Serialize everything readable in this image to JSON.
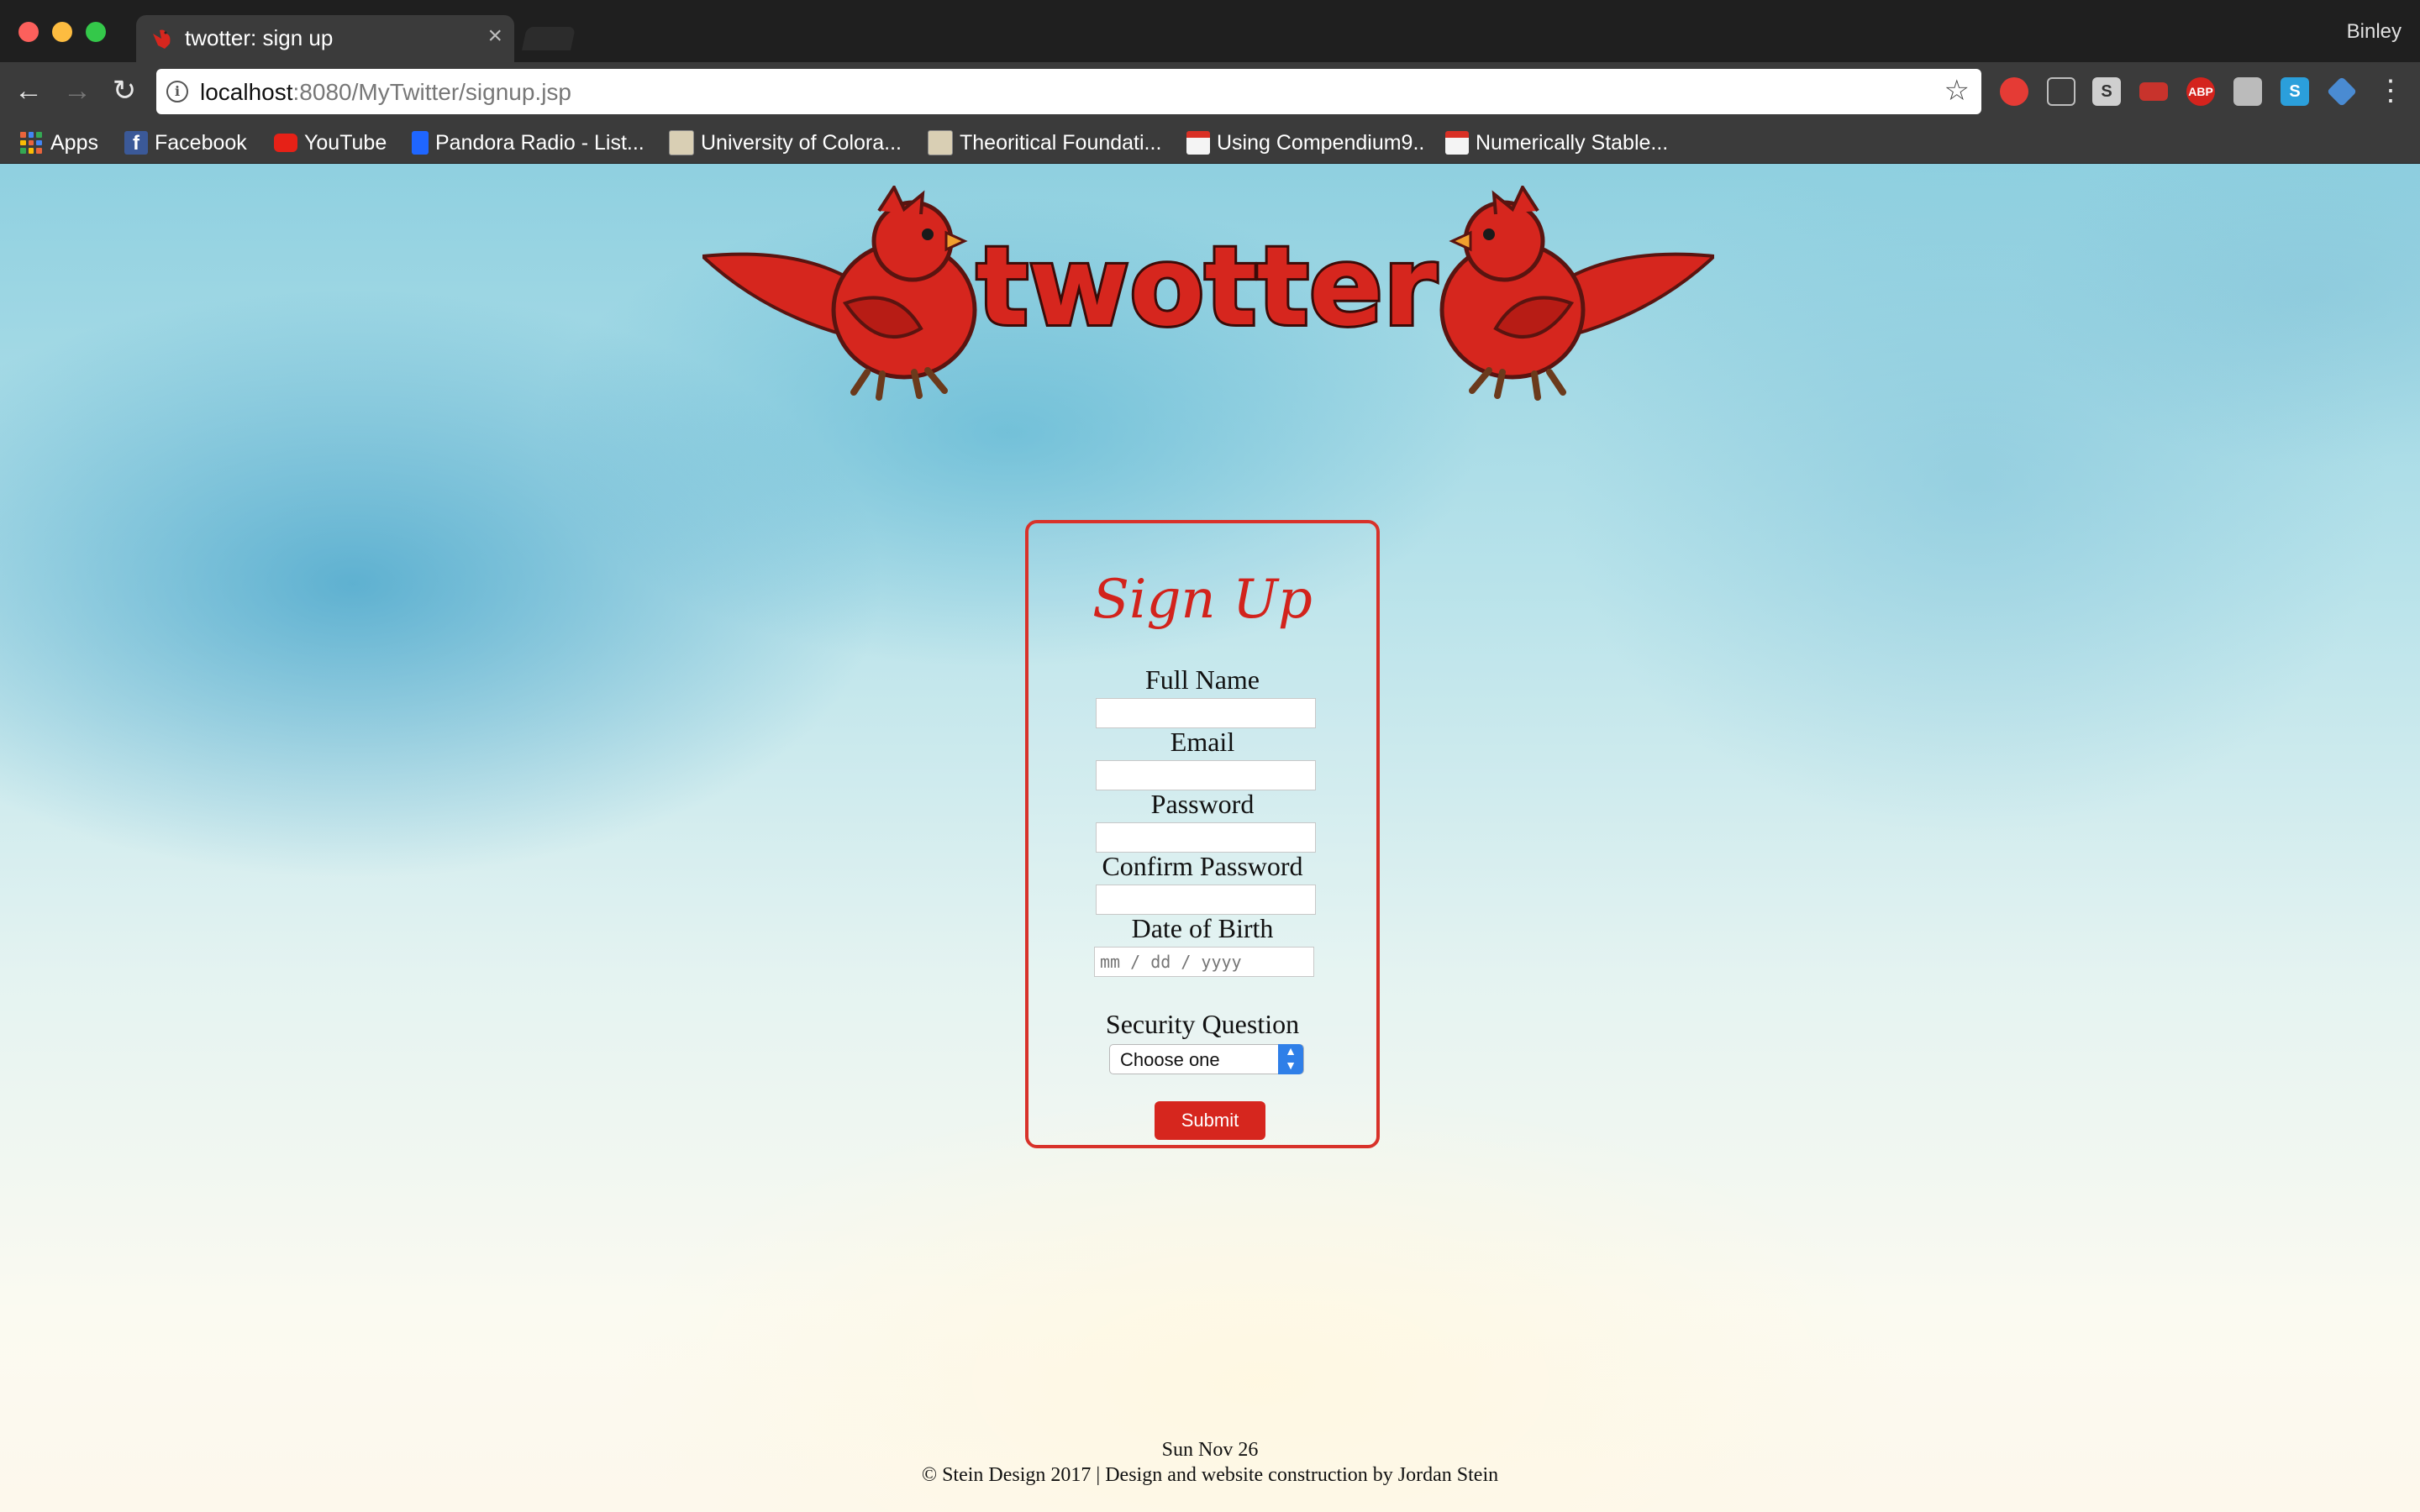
{
  "browser": {
    "tab_title": "twotter: sign up",
    "tab_close": "×",
    "profile_name": "Binley",
    "url_host": "localhost",
    "url_path": ":8080/MyTwitter/signup.jsp"
  },
  "bookmarks": [
    {
      "label": "Apps"
    },
    {
      "label": "Facebook"
    },
    {
      "label": "YouTube"
    },
    {
      "label": "Pandora Radio - List..."
    },
    {
      "label": "University of Colora..."
    },
    {
      "label": "Theoritical Foundati..."
    },
    {
      "label": "Using Compendium9.."
    },
    {
      "label": "Numerically Stable..."
    }
  ],
  "extensions": [
    {
      "icon": "shield-icon",
      "color": "#e53b35"
    },
    {
      "icon": "glasses-icon",
      "color": "#4a4a4a"
    },
    {
      "icon": "s-badge-icon",
      "label": "S",
      "color": "#cfcfcf"
    },
    {
      "icon": "red-box-icon",
      "color": "#c8332c"
    },
    {
      "icon": "adblock-icon",
      "label": "ABP",
      "color": "#d4231d"
    },
    {
      "icon": "cat-icon",
      "color": "#bbbbbb"
    },
    {
      "icon": "skype-icon",
      "label": "S",
      "color": "#2b9fdb"
    },
    {
      "icon": "cube-icon",
      "color": "#4a8bd2"
    }
  ],
  "logo": {
    "text": "twotter"
  },
  "form": {
    "title": "Sign Up",
    "full_name_label": "Full Name",
    "email_label": "Email",
    "password_label": "Password",
    "confirm_password_label": "Confirm Password",
    "dob_label": "Date of Birth",
    "dob_placeholder": "mm / dd / yyyy",
    "security_label": "Security Question",
    "security_selected": "Choose one",
    "submit_label": "Submit"
  },
  "footer": {
    "date": "Sun Nov 26",
    "copyright": "© Stein Design 2017 | Design and website construction by Jordan Stein"
  },
  "colors": {
    "brand_red": "#d6261e",
    "chrome_dark": "#1f1f1f",
    "chrome_toolbar": "#3b3b3b"
  }
}
